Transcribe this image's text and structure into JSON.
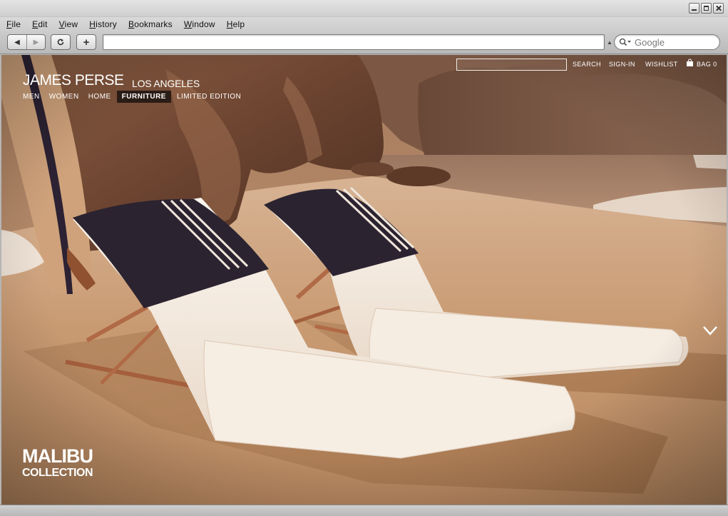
{
  "browser": {
    "menu": [
      "File",
      "Edit",
      "View",
      "History",
      "Bookmarks",
      "Window",
      "Help"
    ],
    "address_value": "",
    "search_placeholder": "Google",
    "icons": {
      "back": "back-arrow-icon",
      "forward": "forward-arrow-icon",
      "reload": "reload-icon",
      "add": "add-bookmark-icon",
      "search": "magnifier-icon"
    }
  },
  "site": {
    "brand": "JAMES PERSE",
    "brand_sub": "LOS ANGELES",
    "utility": {
      "search_value": "",
      "search_label": "SEARCH",
      "signin": "SIGN-IN",
      "wishlist": "WISHLIST",
      "bag": "BAG 0"
    },
    "nav": [
      {
        "label": "MEN",
        "active": false
      },
      {
        "label": "WOMEN",
        "active": false
      },
      {
        "label": "HOME",
        "active": false
      },
      {
        "label": "FURNITURE",
        "active": true
      },
      {
        "label": "LIMITED EDITION",
        "active": false
      }
    ],
    "collection": {
      "title": "MALIBU",
      "subtitle": "COLLECTION"
    },
    "hero_icon": "chevron-down-icon"
  },
  "colors": {
    "chrome_bg": "#c8c8c8",
    "nav_active_bg": "#2a1d16",
    "sand": "#c9a27a",
    "rock": "#6e4a34",
    "towel": "#2b2330",
    "cushion": "#f7efe6"
  }
}
